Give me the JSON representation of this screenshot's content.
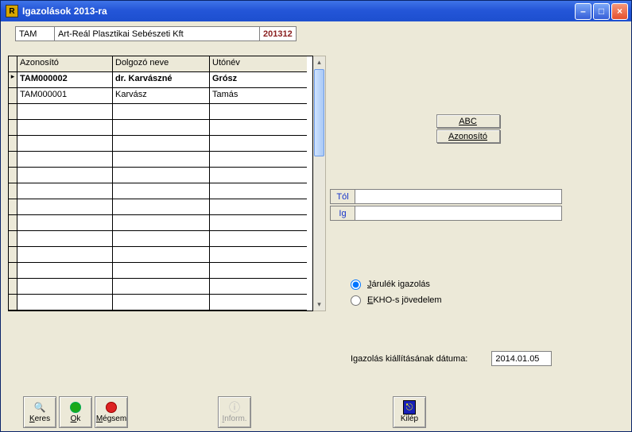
{
  "window": {
    "title": "Igazolások 2013-ra"
  },
  "header": {
    "code": "TAM",
    "company": "Art-Reál Plasztikai Sebészeti Kft",
    "period": "201312"
  },
  "grid": {
    "columns": {
      "id": "Azonosító",
      "name": "Dolgozó neve",
      "first": "Utónév"
    },
    "rows": [
      {
        "id": "TAM000002",
        "name": "dr. Karvászné",
        "first": "Grósz",
        "selected": true
      },
      {
        "id": "TAM000001",
        "name": "Karvász",
        "first": "Tamás",
        "selected": false
      }
    ],
    "blank_rows": 13
  },
  "sort": {
    "abc": "ABC",
    "id": "Azonosító"
  },
  "range": {
    "from_label": "Tól",
    "to_label": "Ig",
    "from": "",
    "to": ""
  },
  "radios": {
    "jarulek": "Járulék igazolás",
    "ekho": "EKHO-s jövedelem",
    "selected": "jarulek"
  },
  "date": {
    "label": "Igazolás kiállításának dátuma:",
    "value": "2014.01.05"
  },
  "buttons": {
    "keres": "Keres",
    "ok": "Ok",
    "megsem": "Mégsem",
    "inform": "Inform.",
    "kilep": "Kilép"
  }
}
